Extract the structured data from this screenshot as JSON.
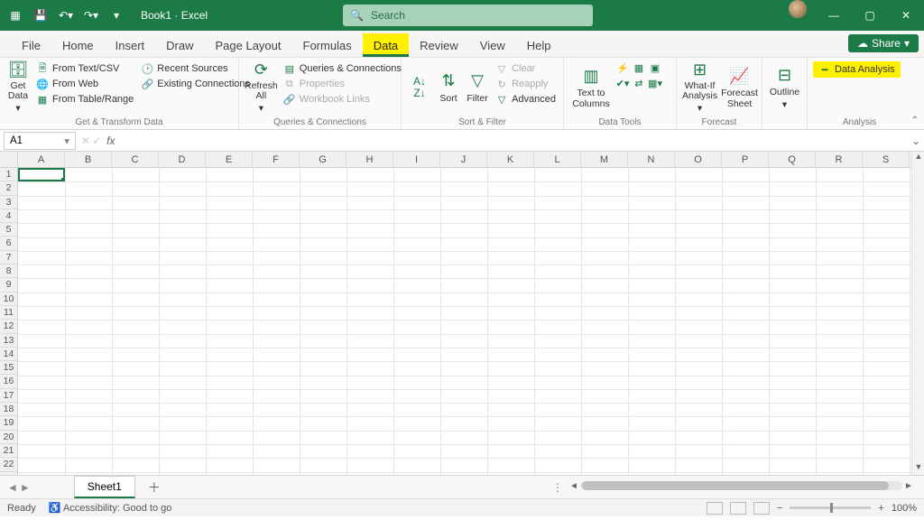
{
  "titlebar": {
    "doc_name": "Book1",
    "app_name": "Excel",
    "search_placeholder": "Search"
  },
  "tabs": {
    "file": "File",
    "home": "Home",
    "insert": "Insert",
    "draw": "Draw",
    "page_layout": "Page Layout",
    "formulas": "Formulas",
    "data": "Data",
    "review": "Review",
    "view": "View",
    "help": "Help",
    "share": "Share"
  },
  "ribbon": {
    "get_data": "Get\nData",
    "from_text_csv": "From Text/CSV",
    "from_web": "From Web",
    "from_table_range": "From Table/Range",
    "recent_sources": "Recent Sources",
    "existing_connections": "Existing Connections",
    "group_get_transform": "Get & Transform Data",
    "refresh_all": "Refresh\nAll",
    "queries_connections": "Queries & Connections",
    "properties": "Properties",
    "workbook_links": "Workbook Links",
    "group_queries": "Queries & Connections",
    "sort": "Sort",
    "filter": "Filter",
    "clear": "Clear",
    "reapply": "Reapply",
    "advanced": "Advanced",
    "group_sort_filter": "Sort & Filter",
    "text_to_columns": "Text to\nColumns",
    "group_data_tools": "Data Tools",
    "what_if": "What-If\nAnalysis",
    "forecast_sheet": "Forecast\nSheet",
    "group_forecast": "Forecast",
    "outline": "Outline",
    "data_analysis": "Data Analysis",
    "group_analysis": "Analysis"
  },
  "formula_bar": {
    "cell_ref": "A1"
  },
  "columns": [
    "A",
    "B",
    "C",
    "D",
    "E",
    "F",
    "G",
    "H",
    "I",
    "J",
    "K",
    "L",
    "M",
    "N",
    "O",
    "P",
    "Q",
    "R",
    "S"
  ],
  "rows": [
    "1",
    "2",
    "3",
    "4",
    "5",
    "6",
    "7",
    "8",
    "9",
    "10",
    "11",
    "12",
    "13",
    "14",
    "15",
    "16",
    "17",
    "18",
    "19",
    "20",
    "21",
    "22"
  ],
  "sheet": {
    "name": "Sheet1"
  },
  "status": {
    "ready": "Ready",
    "accessibility": "Accessibility: Good to go",
    "zoom": "100%"
  }
}
